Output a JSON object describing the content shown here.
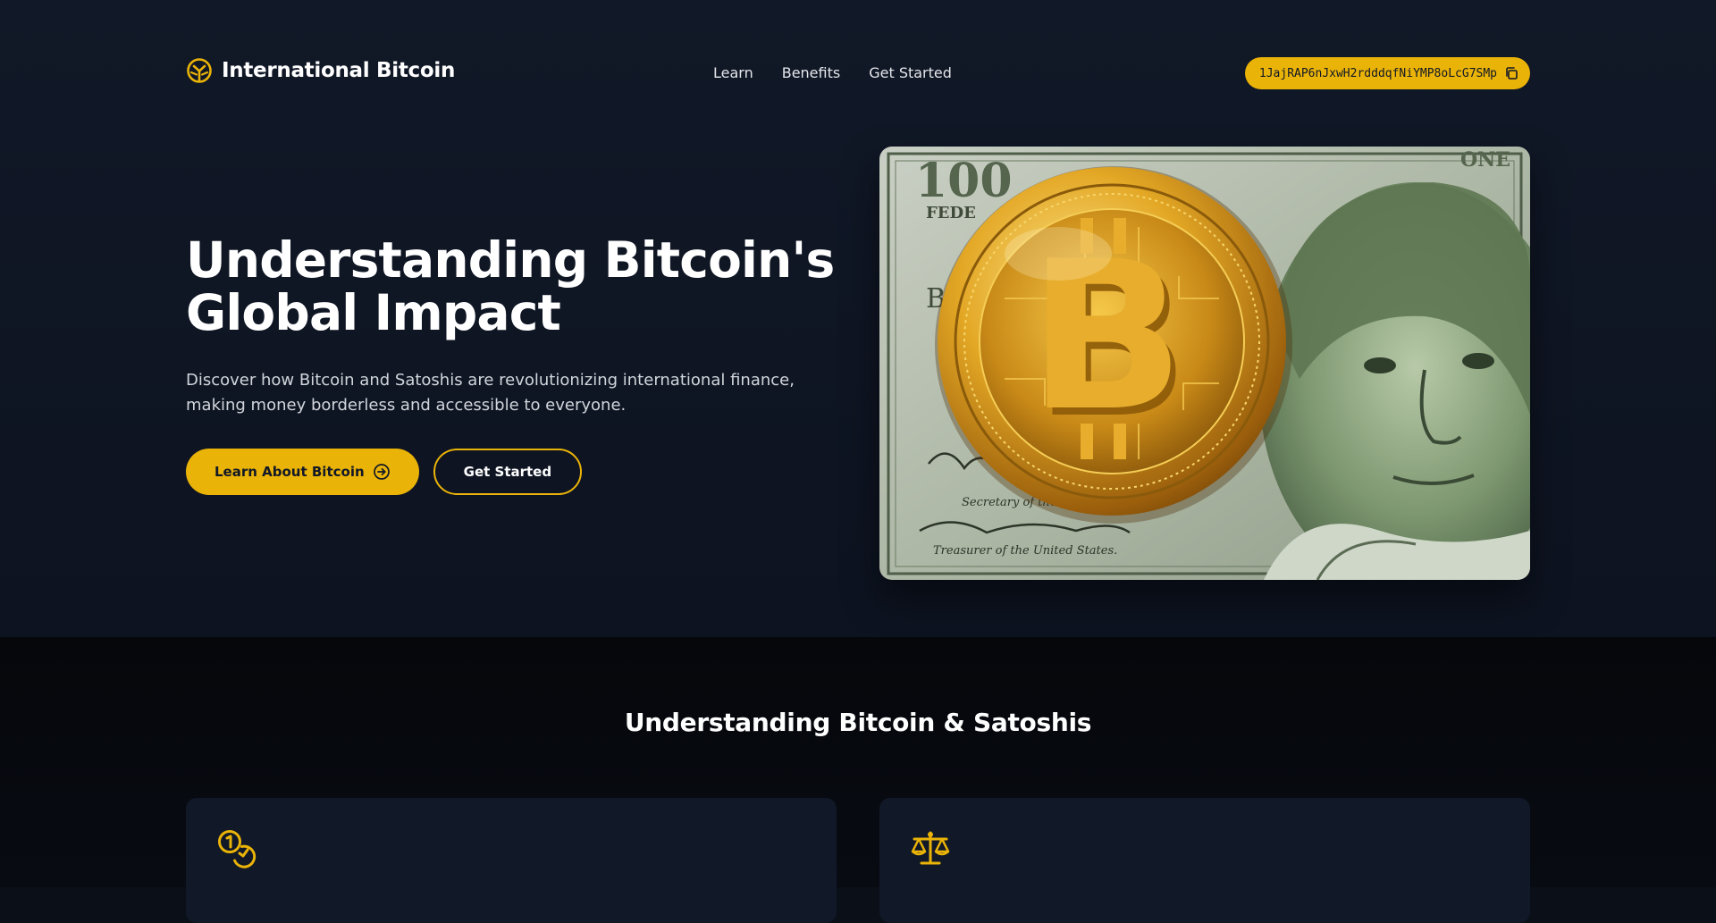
{
  "brand": {
    "name": "International Bitcoin",
    "logo_icon": "bitcoin-logo-icon"
  },
  "nav": {
    "items": [
      {
        "label": "Learn"
      },
      {
        "label": "Benefits"
      },
      {
        "label": "Get Started"
      }
    ]
  },
  "wallet": {
    "address": "1JajRAP6nJxwH2rdddqfNiYMP8oLcG7SMp",
    "copy_icon": "copy-icon"
  },
  "hero": {
    "title": "Understanding Bitcoin's Global Impact",
    "description": "Discover how Bitcoin and Satoshis are revolutionizing international finance, making money borderless and accessible to everyone.",
    "primary_button": "Learn About Bitcoin",
    "secondary_button": "Get Started",
    "image_subject": "gold bitcoin coin on a 100 dollar bill"
  },
  "section": {
    "title": "Understanding Bitcoin & Satoshis",
    "cards": [
      {
        "icon": "coins-icon"
      },
      {
        "icon": "scale-icon"
      }
    ]
  },
  "colors": {
    "accent": "#eab308",
    "background": "#111827",
    "section_background": "#05070b",
    "card_background": "#111827"
  }
}
